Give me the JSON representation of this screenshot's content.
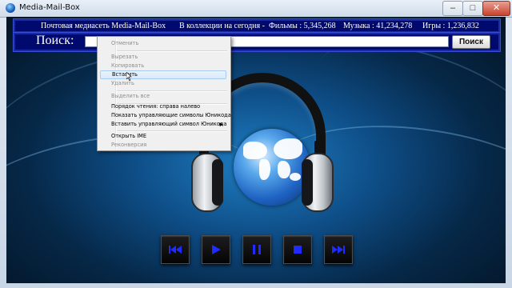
{
  "window": {
    "title": "Media-Mail-Box",
    "min_label": "–",
    "max_label": "□",
    "close_label": "✕"
  },
  "info_bar": {
    "postal": "Почтовая медиасеть  Media-Mail-Box",
    "collection": "В коллекции на сегодня   -",
    "films": "Фильмы : 5,345,268",
    "music": "Музыка : 41,234,278",
    "games": "Игры : 1,236,832"
  },
  "search": {
    "label": "Поиск:",
    "value": "",
    "button_label": "Поиск"
  },
  "context_menu": {
    "items": [
      {
        "label": "Отменить",
        "disabled": true
      },
      {
        "label": "Вырезать",
        "disabled": true
      },
      {
        "label": "Копировать",
        "disabled": true
      },
      {
        "label": "Вставить",
        "disabled": false
      },
      {
        "label": "Удалить",
        "disabled": true
      },
      {
        "label": "Выделить все",
        "disabled": true
      },
      {
        "label": "Порядок чтения: справа налево",
        "disabled": false
      },
      {
        "label": "Показать управляющие символы Юникода",
        "disabled": false
      },
      {
        "label": "Вставить управляющий символ Юникода",
        "disabled": false
      },
      {
        "label": "Открыть IME",
        "disabled": false
      },
      {
        "label": "Реконверсия",
        "disabled": true
      }
    ],
    "hover_index": 3
  },
  "media_controls": {
    "buttons": [
      "skip-back-icon",
      "play-icon",
      "pause-icon",
      "stop-icon",
      "skip-forward-icon"
    ],
    "icon_color": "#1f2bff"
  },
  "colors": {
    "bar_bg": "#000a6e",
    "bar_border": "#3b4ed6",
    "accent_icon": "#1f2bff"
  }
}
